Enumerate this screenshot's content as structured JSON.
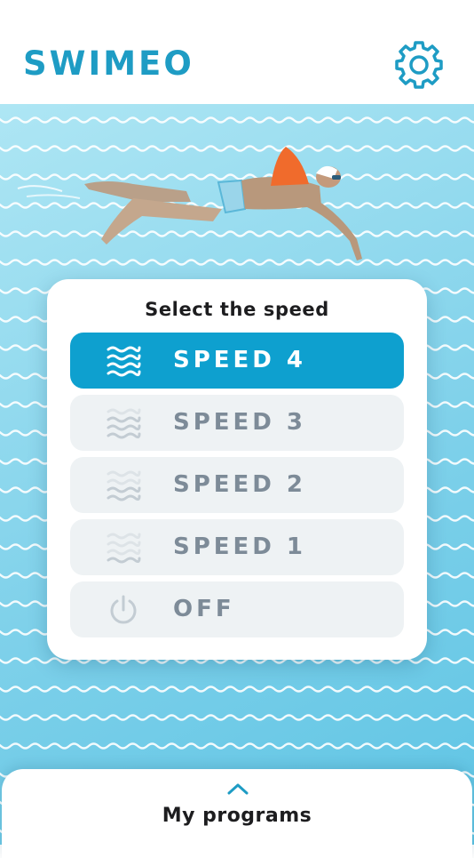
{
  "header": {
    "logo": "SWIMEO",
    "settings_icon": "gear-icon"
  },
  "speed_panel": {
    "title": "Select the speed",
    "options": [
      {
        "label": "SPEED 4",
        "icon": "waves-icon",
        "selected": true
      },
      {
        "label": "SPEED 3",
        "icon": "waves-icon",
        "selected": false
      },
      {
        "label": "SPEED 2",
        "icon": "waves-icon",
        "selected": false
      },
      {
        "label": "SPEED 1",
        "icon": "waves-icon",
        "selected": false
      },
      {
        "label": "OFF",
        "icon": "power-icon",
        "selected": false
      }
    ]
  },
  "bottom_sheet": {
    "label": "My programs",
    "icon": "chevron-up-icon"
  },
  "colors": {
    "brand": "#1e9cc4",
    "active": "#0ea0cf",
    "inactive_bg": "#eef2f4",
    "inactive_text": "#7d8b98"
  }
}
